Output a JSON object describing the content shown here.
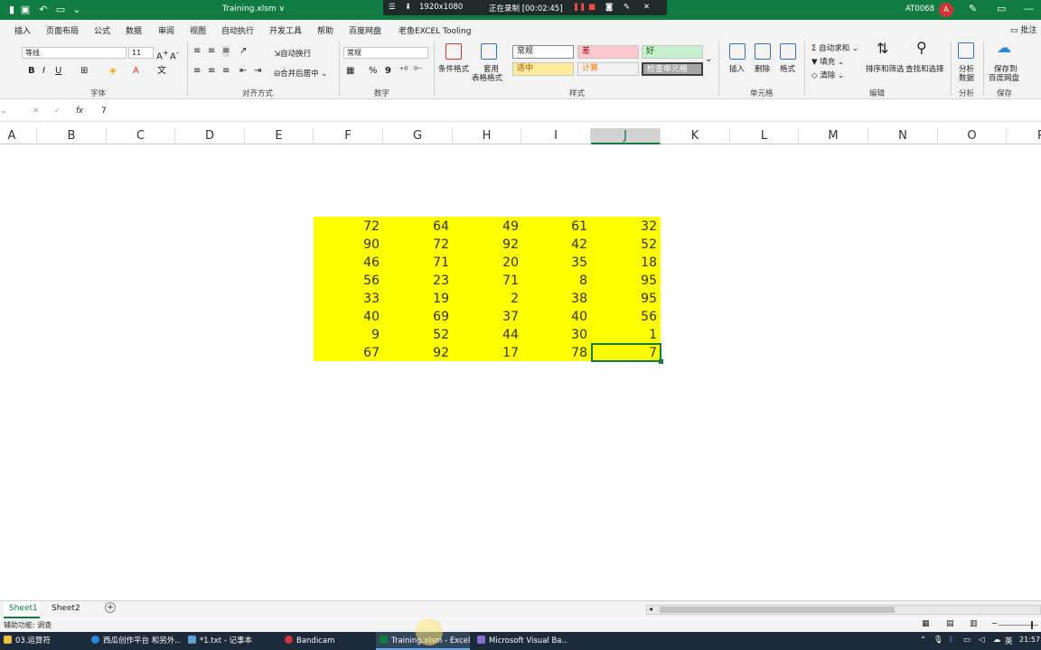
{
  "title_bar": {
    "doc_title": "Training.xlsm ∨",
    "recording": {
      "resolution": "1920x1080",
      "status": "正在录制 [00:02:45]"
    },
    "user_name": "AT0068",
    "avatar_letter": "A"
  },
  "ribbon_tabs": [
    "插入",
    "页面布局",
    "公式",
    "数据",
    "审阅",
    "视图",
    "自动执行",
    "开发工具",
    "帮助",
    "百度网盘",
    "老鱼EXCEL Tooling"
  ],
  "comment_button": "批注",
  "ribbon": {
    "font_name": "等线",
    "font_size": "11",
    "bold": "B",
    "italic": "I",
    "underline": "U",
    "wrap_text": "自动换行",
    "merge_center": "合并后居中",
    "number_format": "常规",
    "percent": "%",
    "comma": "9",
    "conditional_format": "条件格式",
    "table_format": [
      "套用",
      "表格格式"
    ],
    "styles": {
      "normal": "常规",
      "bad": "差",
      "good": "好",
      "neutral": "适中",
      "calc": "计算",
      "check": "检查单元格"
    },
    "insert": "插入",
    "delete": "删除",
    "format": "格式",
    "autosum": "自动求和",
    "fill": "填充",
    "clear": "清除",
    "sort_filter": "排序和筛选",
    "find_select": "查找和选择",
    "analyze": [
      "分析",
      "数据"
    ],
    "save_baidu": [
      "保存到",
      "百度网盘"
    ],
    "group_labels": {
      "font": "字体",
      "align": "对齐方式",
      "number": "数字",
      "styles": "样式",
      "cells": "单元格",
      "edit": "编辑",
      "analysis": "分析",
      "save": "保存"
    }
  },
  "formula_bar": {
    "value": "7",
    "fx": "fx"
  },
  "columns": [
    "A",
    "B",
    "C",
    "D",
    "E",
    "F",
    "G",
    "H",
    "I",
    "J",
    "K",
    "L",
    "M",
    "N",
    "O",
    "P"
  ],
  "selected_column": "J",
  "cells": {
    "F": [
      72,
      90,
      46,
      56,
      33,
      40,
      9,
      67
    ],
    "G": [
      64,
      72,
      71,
      23,
      19,
      69,
      52,
      92
    ],
    "H": [
      49,
      92,
      20,
      71,
      2,
      37,
      44,
      17
    ],
    "I": [
      61,
      42,
      35,
      8,
      38,
      40,
      30,
      78
    ],
    "J": [
      32,
      52,
      18,
      95,
      95,
      56,
      1,
      7
    ]
  },
  "fill_color": "#ffff00",
  "sheets": [
    "Sheet1",
    "Sheet2"
  ],
  "status_text": "辅助功能: 调查",
  "taskbar": [
    {
      "label": "03.运算符",
      "color": "#f0c040"
    },
    {
      "label": "西瓜创作平台 和另外...",
      "color": "#2b88d8"
    },
    {
      "label": "*1.txt - 记事本",
      "color": "#5da0d0"
    },
    {
      "label": "Bandicam",
      "color": "#d13438"
    },
    {
      "label": "Training.xlsm - Excel",
      "color": "#107c41"
    },
    {
      "label": "Microsoft Visual Ba...",
      "color": "#8a6fd0"
    }
  ],
  "tray": {
    "lang": "英",
    "time": "21:57"
  }
}
